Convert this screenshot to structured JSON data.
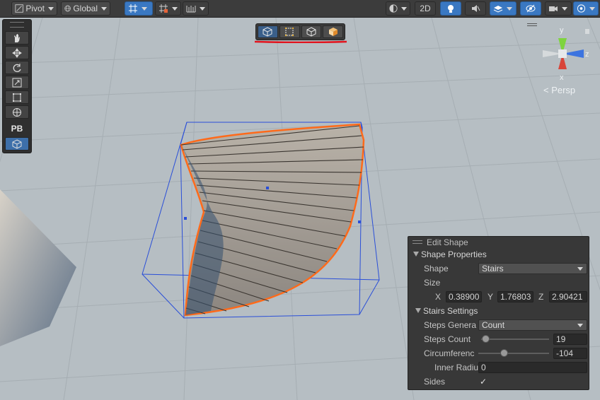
{
  "toolbar": {
    "pivot_label": "Pivot",
    "global_label": "Global",
    "mode_2d_label": "2D"
  },
  "shape_toolbar": {
    "buttons": [
      "shape-mode-object-icon",
      "shape-mode-bounds-icon",
      "shape-mode-face-icon",
      "shape-mode-edit-icon"
    ]
  },
  "toolpanel": {
    "pb_label": "PB"
  },
  "gizmo": {
    "y_label": "y",
    "z_label": "z",
    "x_label": "x",
    "persp_label": "< Persp"
  },
  "edit_shape": {
    "title": "Edit Shape",
    "shape_properties_label": "Shape Properties",
    "shape_label": "Shape",
    "shape_value": "Stairs",
    "size_label": "Size",
    "size_x_label": "X",
    "size_x": "0.38900",
    "size_y_label": "Y",
    "size_y": "1.76803",
    "size_z_label": "Z",
    "size_z": "2.90421",
    "stairs_settings_label": "Stairs Settings",
    "steps_generation_label": "Steps Genera",
    "steps_generation_value": "Count",
    "steps_count_label": "Steps Count",
    "steps_count_value": "19",
    "circumference_label": "Circumferenc",
    "circumference_value": "-104",
    "inner_radius_label": "Inner Radiu",
    "inner_radius_value": "0",
    "sides_label": "Sides",
    "sides_checked": "✓"
  },
  "colors": {
    "accent_blue": "#3a78c2",
    "selection_orange": "#ff6a1a",
    "annotation_red": "#e0141e",
    "bounds_blue": "#2a4fd8"
  }
}
